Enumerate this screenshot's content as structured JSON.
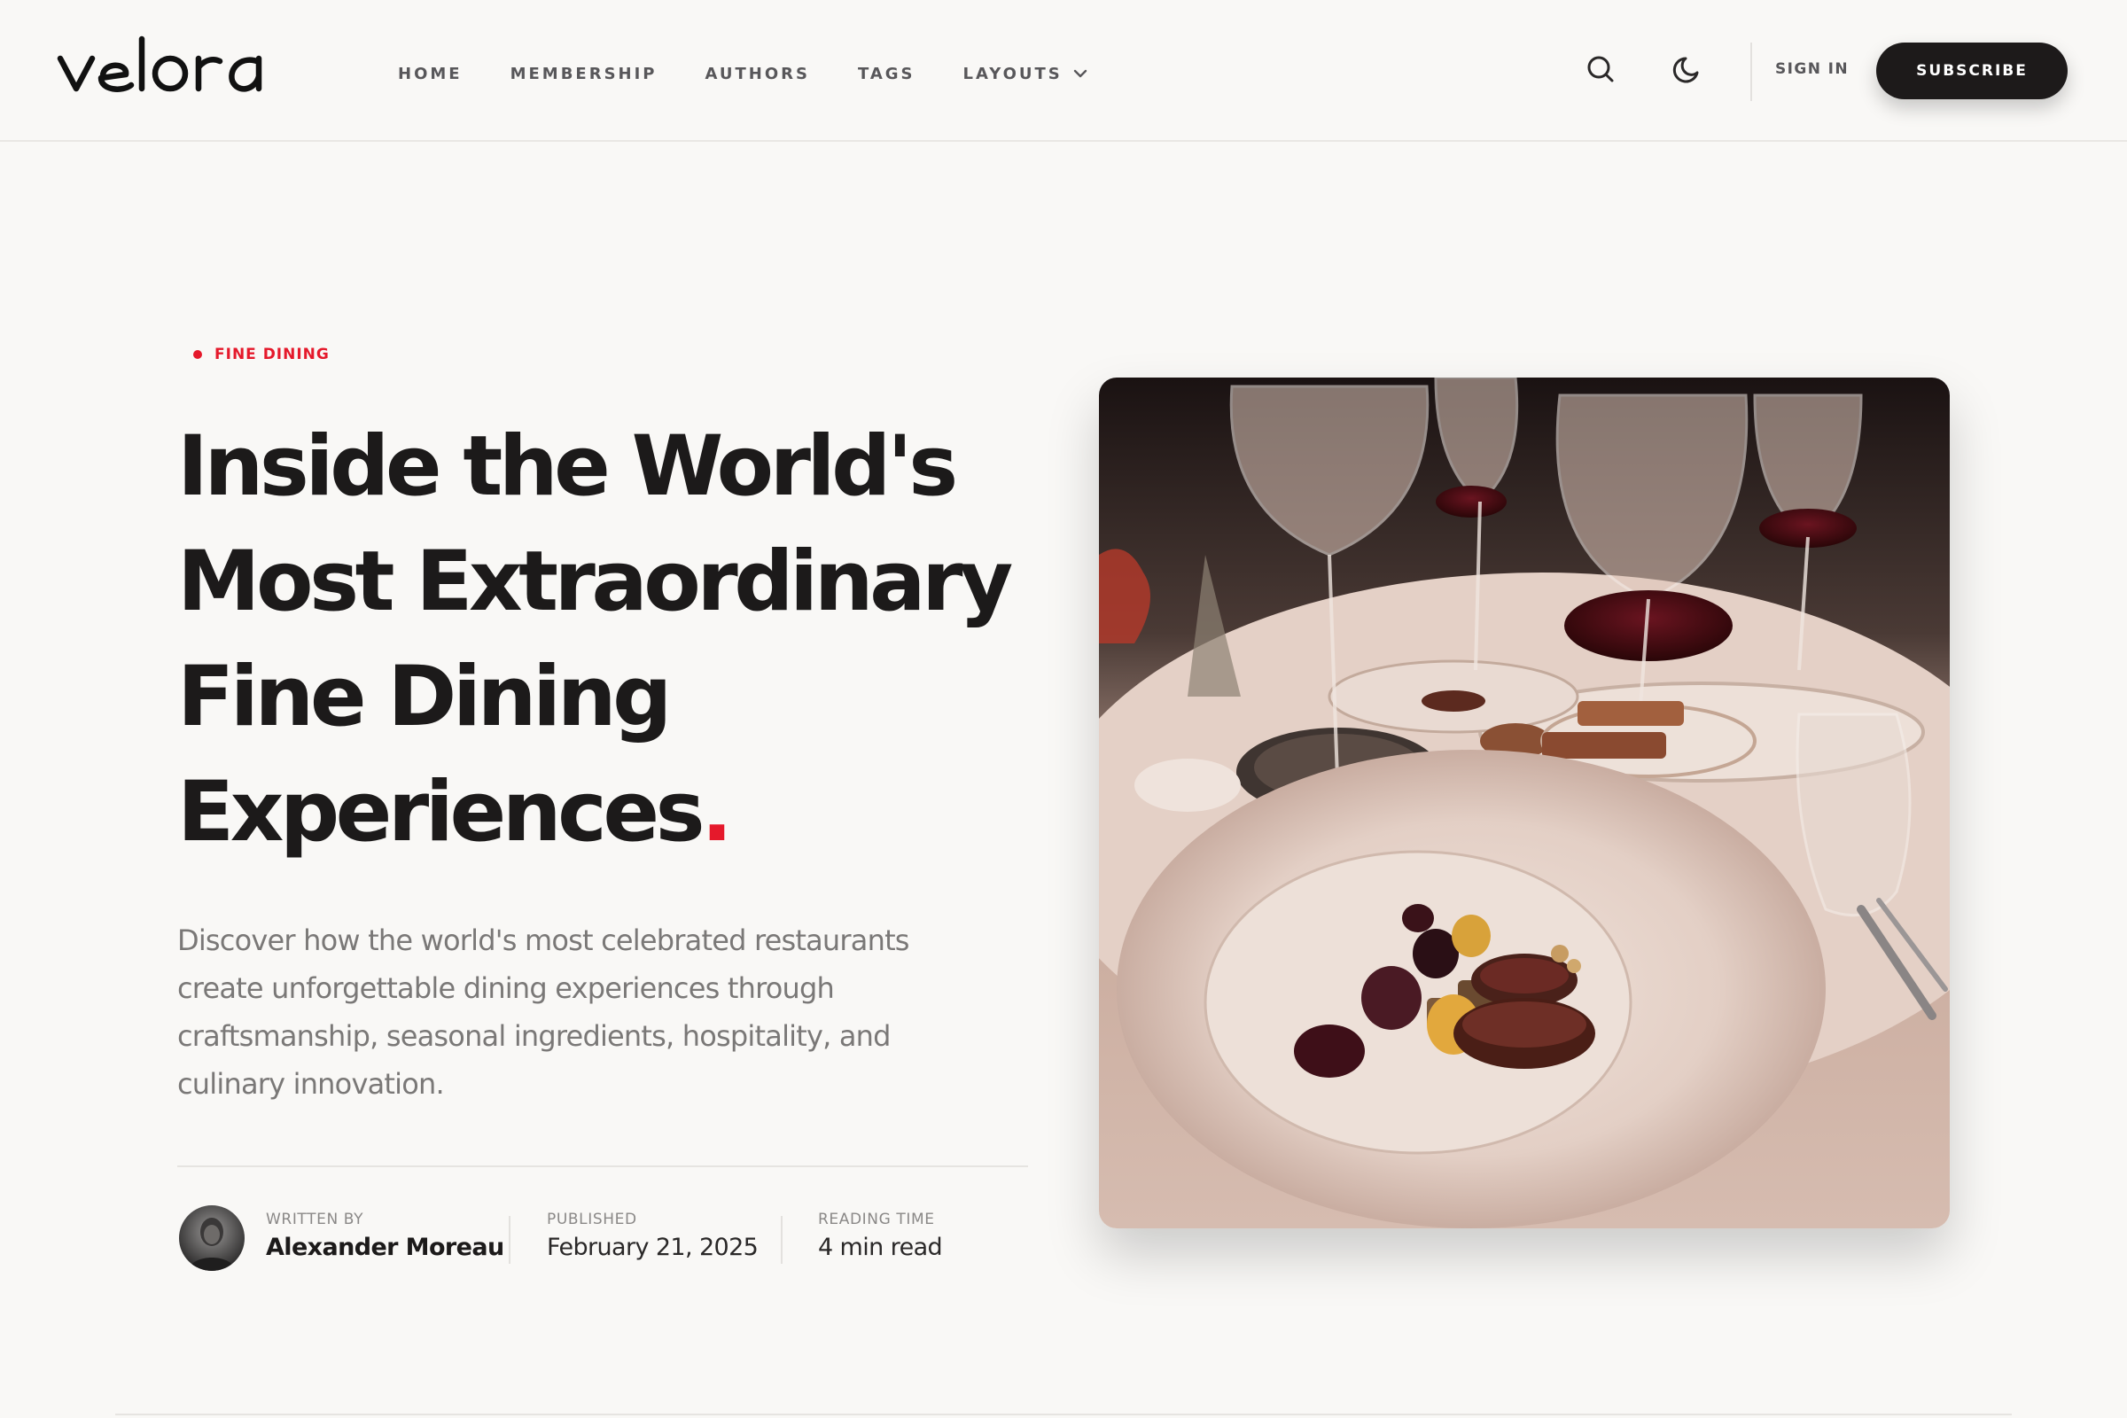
{
  "brand": {
    "logo_text": "velora"
  },
  "nav": {
    "items": [
      {
        "label": "HOME"
      },
      {
        "label": "MEMBERSHIP"
      },
      {
        "label": "AUTHORS"
      },
      {
        "label": "TAGS"
      },
      {
        "label": "LAYOUTS",
        "has_dropdown": true
      }
    ]
  },
  "header": {
    "search_icon": "search-icon",
    "theme_icon": "moon-icon",
    "sign_in_label": "SIGN IN",
    "subscribe_label": "SUBSCRIBE"
  },
  "article": {
    "category": "FINE DINING",
    "title_lines": [
      "Inside the World's",
      "Most Extraordinary",
      "Fine Dining",
      "Experiences"
    ],
    "title_end_mark": ".",
    "excerpt_lines": [
      "Discover how the world's most celebrated restaurants",
      "create unforgettable dining experiences through",
      "craftsmanship, seasonal ingredients, hospitality, and",
      "culinary innovation."
    ],
    "meta": {
      "written_by_label": "WRITTEN BY",
      "author": "Alexander Moreau",
      "published_label": "PUBLISHED",
      "published_date": "February 21, 2025",
      "reading_time_label": "READING TIME",
      "reading_time": "4 min read"
    },
    "hero_image": "fine-dining-table-photo"
  },
  "colors": {
    "accent": "#e5192b",
    "background": "#f9f8f6",
    "text_dark": "#1c1b1b",
    "button_dark": "#1d1a1a"
  }
}
